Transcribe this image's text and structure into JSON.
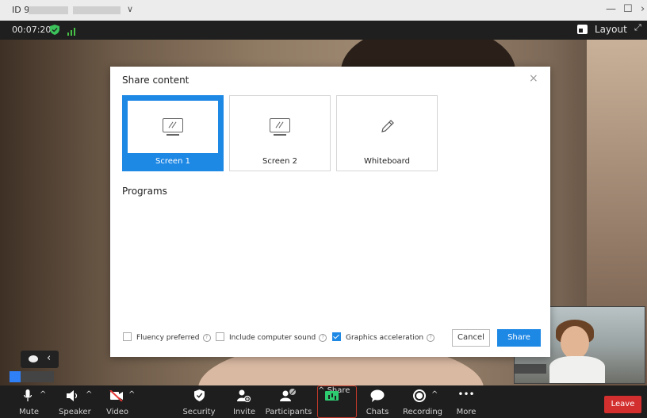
{
  "titlebar": {
    "meeting_id_prefix": "ID 9",
    "chevron": "∨",
    "minimize": "—",
    "maximize": "☐",
    "close_partial": "›"
  },
  "status": {
    "timer": "00:07:20",
    "layout_label": "Layout",
    "expand_icon": "expand-icon",
    "shield_color": "#3cc25a",
    "signal_color": "#47c247"
  },
  "dialog": {
    "title": "Share content",
    "close_glyph": "×",
    "tiles": [
      {
        "label": "Screen 1",
        "icon": "monitor-icon",
        "selected": true
      },
      {
        "label": "Screen 2",
        "icon": "monitor-icon",
        "selected": false
      },
      {
        "label": "Whiteboard",
        "icon": "pencil-icon",
        "selected": false
      }
    ],
    "section_programs": "Programs",
    "options": [
      {
        "label": "Fluency preferred",
        "checked": false
      },
      {
        "label": "Include computer sound",
        "checked": false
      },
      {
        "label": "Graphics acceleration",
        "checked": true
      }
    ],
    "help_glyph": "?",
    "cancel_label": "Cancel",
    "share_label": "Share",
    "accent": "#1e88e5"
  },
  "toolbar": {
    "items": [
      {
        "label": "Mute",
        "icon": "microphone-icon"
      },
      {
        "label": "Speaker",
        "icon": "speaker-icon"
      },
      {
        "label": "Video",
        "icon": "video-off-icon"
      },
      {
        "label": "Security",
        "icon": "shield-icon"
      },
      {
        "label": "Invite",
        "icon": "add-person-icon"
      },
      {
        "label": "Participants",
        "icon": "participants-icon"
      },
      {
        "label": "Share",
        "icon": "share-screen-icon"
      },
      {
        "label": "Chats",
        "icon": "chat-bubble-icon"
      },
      {
        "label": "Recording",
        "icon": "record-icon"
      },
      {
        "label": "More",
        "icon": "more-icon"
      }
    ],
    "caret": "^",
    "more_glyph": "•••",
    "leave_label": "Leave",
    "leave_color": "#d32f2f"
  },
  "chat_widget": {
    "arrow": "‹"
  }
}
